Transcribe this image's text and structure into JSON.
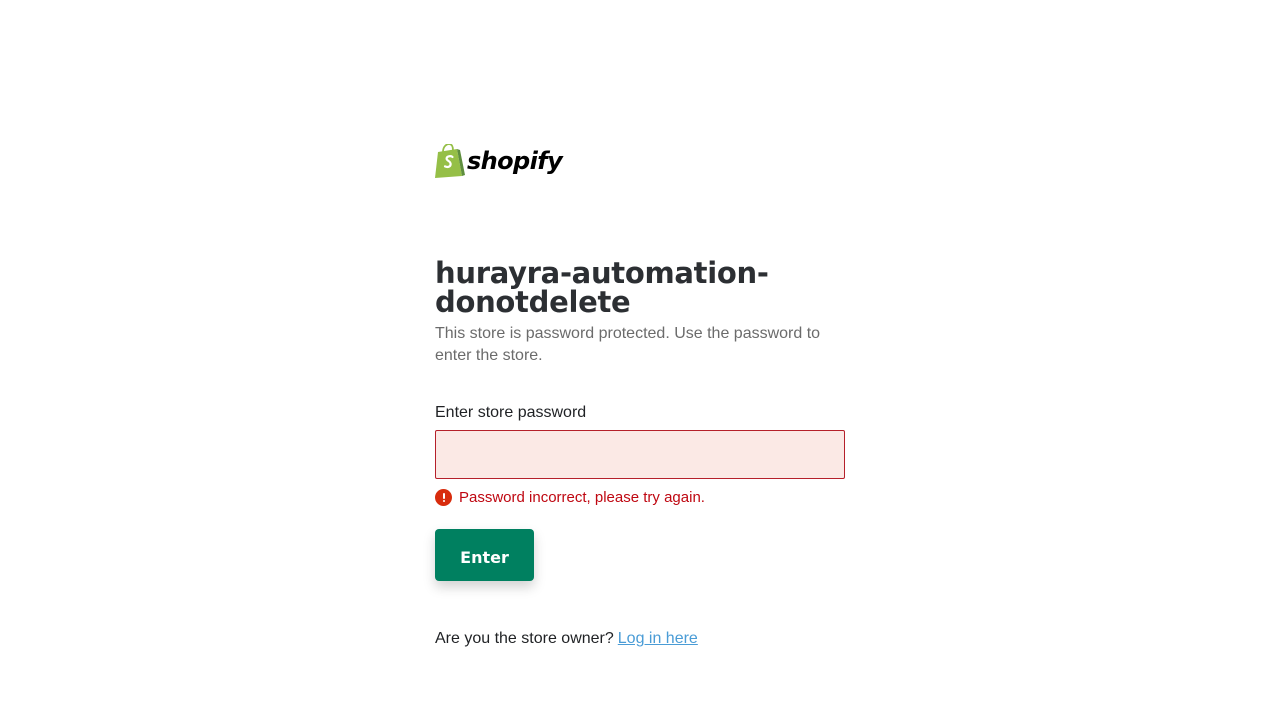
{
  "brand": {
    "logo_text": "shopify",
    "logo_icon": "shopify-bag-icon",
    "colors": {
      "bag_light": "#95bf47",
      "bag_dark": "#5e8e3e"
    }
  },
  "store": {
    "title": "hurayra-automation-donotdelete",
    "subtitle": "This store is password protected. Use the password to enter the store."
  },
  "form": {
    "password_label": "Enter store password",
    "password_value": "",
    "error_icon": "alert-circle-icon",
    "error_message": "Password incorrect, please try again.",
    "submit_label": "Enter"
  },
  "footer": {
    "owner_prompt": "Are you the store owner?",
    "login_link": "Log in here"
  },
  "colors": {
    "primary_button": "#008060",
    "error": "#bf0711",
    "input_error_bg": "#fbe9e5",
    "link": "#4a9cd6"
  }
}
